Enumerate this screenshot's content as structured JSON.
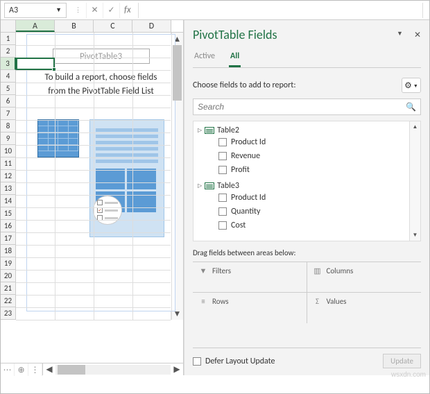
{
  "namebox": "A3",
  "fx_label": "fx",
  "columns": [
    "A",
    "B",
    "C",
    "D"
  ],
  "selected_col": 0,
  "rows": [
    "1",
    "2",
    "3",
    "4",
    "5",
    "6",
    "7",
    "8",
    "9",
    "10",
    "11",
    "12",
    "13",
    "14",
    "15",
    "16",
    "17",
    "18",
    "19",
    "20",
    "21",
    "22",
    "23"
  ],
  "selected_row": 2,
  "pivot_placeholder": {
    "title": "PivotTable3",
    "msg": "To build a report, choose fields from the PivotTable Field List"
  },
  "pane": {
    "title": "PivotTable Fields",
    "tabs": {
      "active": "Active",
      "all": "All"
    },
    "choose_label": "Choose fields to add to report:",
    "search_placeholder": "Search"
  },
  "tables": [
    {
      "name": "Table2",
      "fields": [
        "Product Id",
        "Revenue",
        "Profit"
      ]
    },
    {
      "name": "Table3",
      "fields": [
        "Product Id",
        "Quantity",
        "Cost"
      ]
    }
  ],
  "drag_label": "Drag fields between areas below:",
  "areas": {
    "filters": "Filters",
    "columns": "Columns",
    "rows": "Rows",
    "values": "Values"
  },
  "defer_label": "Defer Layout Update",
  "update_label": "Update",
  "watermark": "wsxdn.com"
}
